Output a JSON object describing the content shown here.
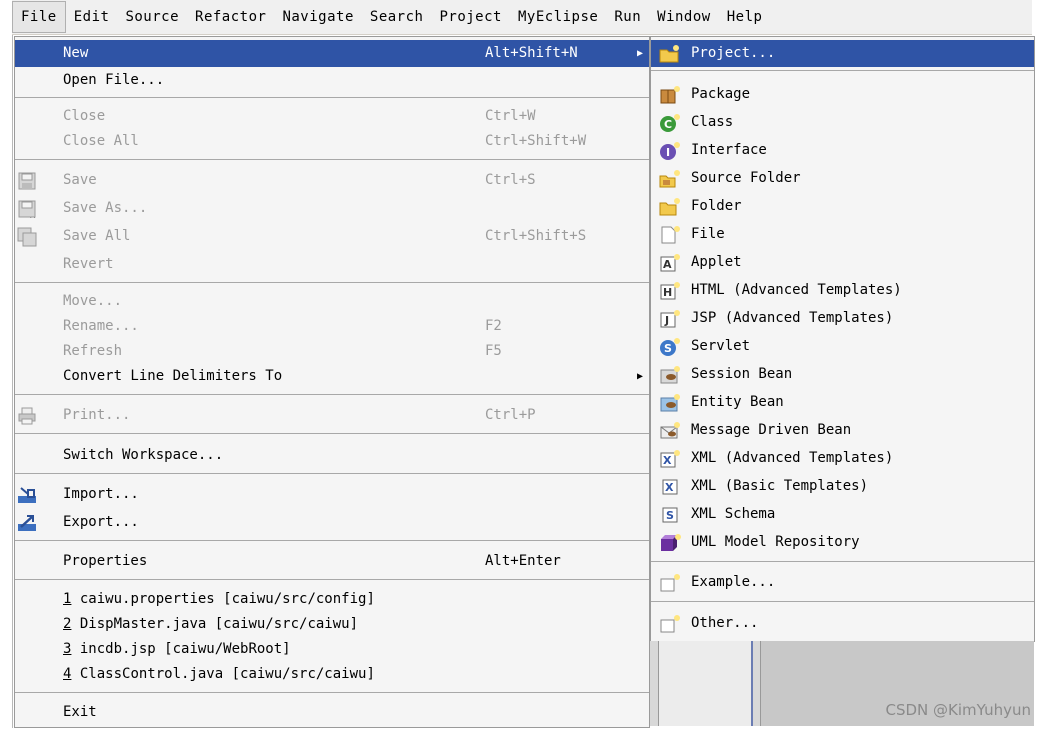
{
  "menubar": {
    "items": [
      "File",
      "Edit",
      "Source",
      "Refactor",
      "Navigate",
      "Search",
      "Project",
      "MyEclipse",
      "Run",
      "Window",
      "Help"
    ]
  },
  "file_menu": {
    "new": {
      "label": "New",
      "shortcut": "Alt+Shift+N"
    },
    "open_file": "Open File...",
    "close": {
      "label": "Close",
      "shortcut": "Ctrl+W"
    },
    "close_all": {
      "label": "Close All",
      "shortcut": "Ctrl+Shift+W"
    },
    "save": {
      "label": "Save",
      "shortcut": "Ctrl+S"
    },
    "save_as": "Save As...",
    "save_all": {
      "label": "Save All",
      "shortcut": "Ctrl+Shift+S"
    },
    "revert": "Revert",
    "move": "Move...",
    "rename": {
      "label": "Rename...",
      "shortcut": "F2"
    },
    "refresh": {
      "label": "Refresh",
      "shortcut": "F5"
    },
    "convert": "Convert Line Delimiters To",
    "print": {
      "label": "Print...",
      "shortcut": "Ctrl+P"
    },
    "switch_workspace": "Switch Workspace...",
    "import": "Import...",
    "export": "Export...",
    "properties": {
      "label": "Properties",
      "shortcut": "Alt+Enter"
    },
    "recent": [
      {
        "num": "1",
        "text": "caiwu.properties  [caiwu/src/config]"
      },
      {
        "num": "2",
        "text": "DispMaster.java  [caiwu/src/caiwu]"
      },
      {
        "num": "3",
        "text": "incdb.jsp  [caiwu/WebRoot]"
      },
      {
        "num": "4",
        "text": "ClassControl.java  [caiwu/src/caiwu]"
      }
    ],
    "exit": "Exit"
  },
  "new_submenu": {
    "items": [
      {
        "label": "Project...",
        "icon": "project-icon"
      },
      {
        "label": "Package",
        "icon": "package-icon"
      },
      {
        "label": "Class",
        "icon": "class-icon"
      },
      {
        "label": "Interface",
        "icon": "interface-icon"
      },
      {
        "label": "Source Folder",
        "icon": "source-folder-icon"
      },
      {
        "label": "Folder",
        "icon": "folder-icon"
      },
      {
        "label": "File",
        "icon": "file-icon"
      },
      {
        "label": "Applet",
        "icon": "applet-icon"
      },
      {
        "label": "HTML (Advanced Templates)",
        "icon": "html-icon"
      },
      {
        "label": "JSP (Advanced Templates)",
        "icon": "jsp-icon"
      },
      {
        "label": "Servlet",
        "icon": "servlet-icon"
      },
      {
        "label": "Session Bean",
        "icon": "session-bean-icon"
      },
      {
        "label": "Entity Bean",
        "icon": "entity-bean-icon"
      },
      {
        "label": "Message Driven Bean",
        "icon": "message-bean-icon"
      },
      {
        "label": "XML (Advanced Templates)",
        "icon": "xml-advanced-icon"
      },
      {
        "label": "XML (Basic Templates)",
        "icon": "xml-basic-icon"
      },
      {
        "label": "XML Schema",
        "icon": "xml-schema-icon"
      },
      {
        "label": "UML Model Repository",
        "icon": "uml-icon"
      },
      {
        "label": "Example...",
        "icon": "example-icon"
      },
      {
        "label": "Other...",
        "icon": "other-icon"
      }
    ]
  },
  "watermark": "CSDN @KimYuhyun",
  "colors": {
    "highlight": "#2f54a6",
    "menu_bg": "#f5f5f5",
    "disabled": "#9b9b9b"
  }
}
